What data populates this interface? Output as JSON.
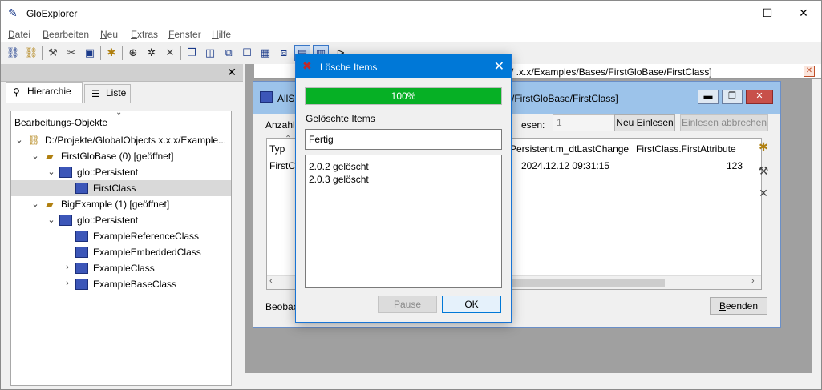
{
  "app": {
    "title": "GloExplorer"
  },
  "window_controls": {
    "minimize": "—",
    "maximize": "☐",
    "close": "✕"
  },
  "menu": [
    {
      "label": "Datei",
      "accel": "D"
    },
    {
      "label": "Bearbeiten",
      "accel": "B"
    },
    {
      "label": "Neu",
      "accel": "N"
    },
    {
      "label": "Extras",
      "accel": "E"
    },
    {
      "label": "Fenster",
      "accel": "F"
    },
    {
      "label": "Hilfe",
      "accel": "H"
    }
  ],
  "left_panel": {
    "close": "✕",
    "tabs": [
      {
        "label": "Hierarchie",
        "active": true
      },
      {
        "label": "Liste",
        "active": false
      }
    ],
    "tree_title": "Bearbeitungs-Objekte",
    "tree": [
      {
        "label": "D:/Projekte/GlobalObjects x.x.x/Example...",
        "toggle": "⌄",
        "icon": "database",
        "indent": 0
      },
      {
        "label": "FirstGloBase (0) [geöffnet]",
        "toggle": "⌄",
        "icon": "folder",
        "indent": 1
      },
      {
        "label": "glo::Persistent",
        "toggle": "⌄",
        "icon": "class",
        "indent": 2
      },
      {
        "label": "FirstClass",
        "toggle": "",
        "icon": "class",
        "indent": 3,
        "selected": true
      },
      {
        "label": "BigExample (1) [geöffnet]",
        "toggle": "⌄",
        "icon": "folder",
        "indent": 1
      },
      {
        "label": "glo::Persistent",
        "toggle": "⌄",
        "icon": "class",
        "indent": 2
      },
      {
        "label": "ExampleReferenceClass",
        "toggle": "",
        "icon": "class",
        "indent": 3
      },
      {
        "label": "ExampleEmbeddedClass",
        "toggle": "",
        "icon": "class",
        "indent": 3
      },
      {
        "label": "ExampleClass",
        "toggle": "›",
        "icon": "class",
        "indent": 3
      },
      {
        "label": "ExampleBaseClass",
        "toggle": "›",
        "icon": "class",
        "indent": 3
      }
    ]
  },
  "doc_tab": {
    "label": "/ .x.x/Examples/Bases/FirstGloBase/FirstClass]",
    "close": "✕"
  },
  "inner_window": {
    "title_left": "AllSe",
    "title_right": "/FirstGloBase/FirstClass]",
    "count_label": "Anzahl:",
    "read_label": "esen:",
    "count_value": "1",
    "reload_button": "Neu Einlesen",
    "abort_button": "Einlesen abbrechen",
    "columns": [
      "Typ",
      "Persistent.m_dtLastChange",
      "FirstClass.FirstAttribute"
    ],
    "rows": [
      {
        "typ": "FirstCl",
        "last_change": "2024.12.12 09:31:15",
        "first_attr": "123"
      }
    ],
    "observe_label": "Beobac",
    "finish_button": "Beenden",
    "finish_accel": "B"
  },
  "dialog": {
    "title": "Lösche Items",
    "close": "✕",
    "progress": 1.0,
    "progress_text": "100%",
    "label": "Gelöschte Items",
    "status": "Fertig",
    "log": [
      "2.0.2 gelöscht",
      "2.0.3 gelöscht"
    ],
    "pause_button": "Pause",
    "ok_button": "OK",
    "progress_color": "#06b025"
  }
}
